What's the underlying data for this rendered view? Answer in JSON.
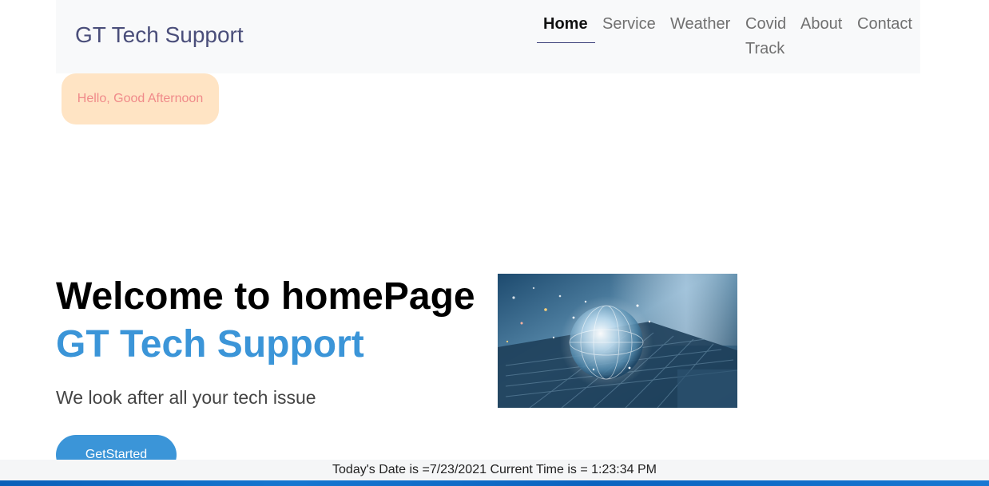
{
  "navbar": {
    "brand": "GT Tech Support",
    "items": [
      {
        "label": "Home",
        "active": true
      },
      {
        "label": "Service",
        "active": false
      },
      {
        "label": "Weather",
        "active": false
      },
      {
        "label": "Covid Track",
        "active": false
      },
      {
        "label": "About",
        "active": false
      },
      {
        "label": "Contact",
        "active": false
      }
    ]
  },
  "greeting": "Hello, Good Afternoon",
  "hero": {
    "title": "Welcome to homePage",
    "brand": "GT Tech Support",
    "subtitle": "We look after all your tech issue",
    "cta_label": "GetStarted"
  },
  "status": "Today's Date is =7/23/2021 Current Time is = 1:23:34 PM",
  "colors": {
    "accent": "#3b95d8",
    "greeting_bg": "#ffe4c4",
    "greeting_text": "#f08a8a",
    "navbar_bg": "#f8f9fa"
  }
}
